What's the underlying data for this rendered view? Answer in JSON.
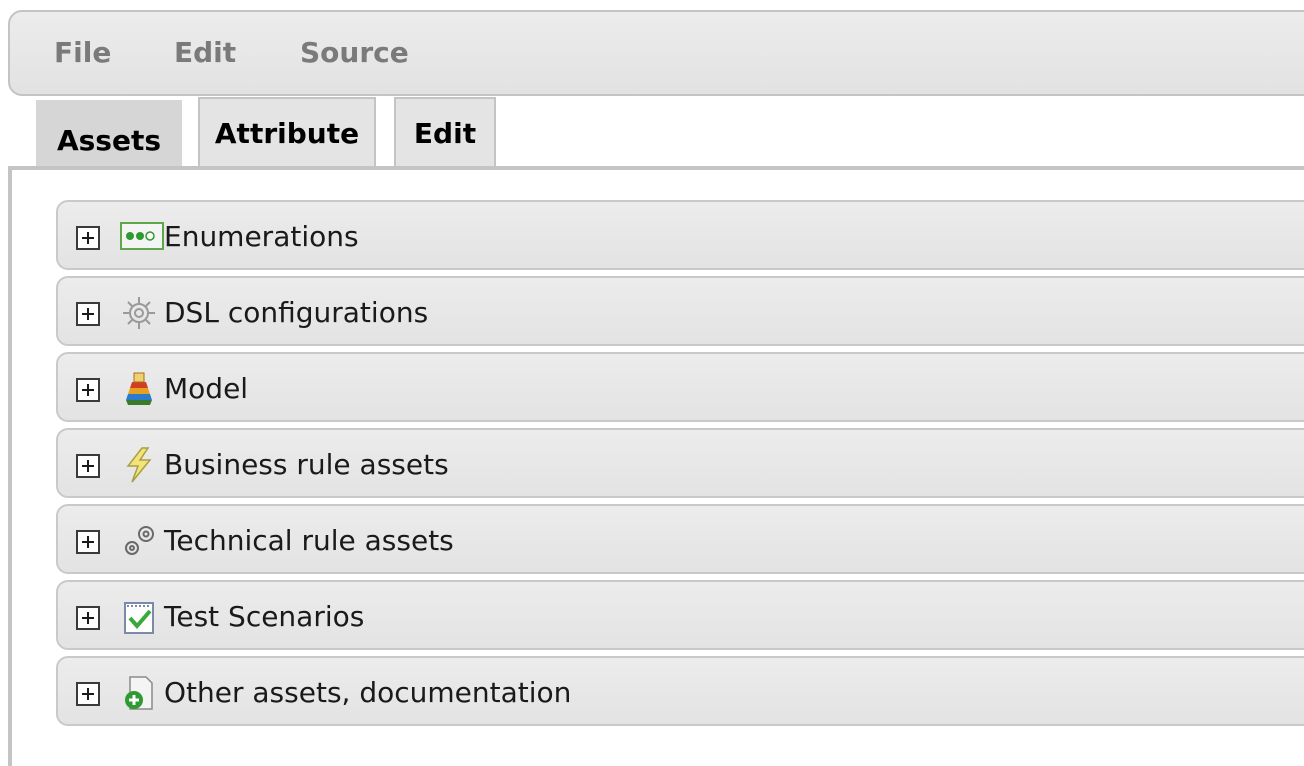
{
  "menu": {
    "file": "File",
    "edit": "Edit",
    "source": "Source"
  },
  "tabs": [
    {
      "label": "Assets",
      "active": true
    },
    {
      "label": "Attribute",
      "active": false
    },
    {
      "label": "Edit",
      "active": false
    }
  ],
  "sections": [
    {
      "label": "Enumerations",
      "icon": "enumeration-icon"
    },
    {
      "label": "DSL configurations",
      "icon": "gear-icon"
    },
    {
      "label": "Model",
      "icon": "model-icon"
    },
    {
      "label": "Business rule assets",
      "icon": "business-rule-icon"
    },
    {
      "label": "Technical rule assets",
      "icon": "technical-rule-icon"
    },
    {
      "label": "Test Scenarios",
      "icon": "test-scenario-icon"
    },
    {
      "label": "Other assets, documentation",
      "icon": "other-assets-icon"
    }
  ]
}
